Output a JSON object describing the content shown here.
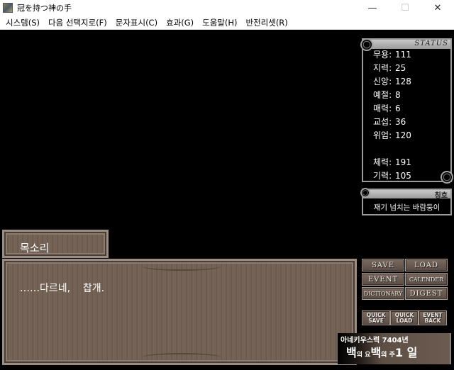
{
  "window": {
    "title": "冠を持つ神の手",
    "minimize": "—",
    "maximize": "☐",
    "close": "✕"
  },
  "menu": [
    {
      "label": "시스템(S)"
    },
    {
      "label": "다음 선택지로(F)"
    },
    {
      "label": "문자표시(C)"
    },
    {
      "label": "효과(G)"
    },
    {
      "label": "도움말(H)"
    },
    {
      "label": "반전리셋(R)"
    }
  ],
  "status": {
    "title": "STATUS",
    "stats": [
      {
        "label": "무용",
        "value": "111"
      },
      {
        "label": "지력",
        "value": "25"
      },
      {
        "label": "신앙",
        "value": "128"
      },
      {
        "label": "예절",
        "value": "8"
      },
      {
        "label": "매력",
        "value": "6"
      },
      {
        "label": "교섭",
        "value": "36"
      },
      {
        "label": "위엄",
        "value": "120"
      },
      {
        "label": "체력",
        "value": "191"
      },
      {
        "label": "기력",
        "value": "105"
      }
    ]
  },
  "honorific": {
    "header": "칭호",
    "value": "재기 넘치는 바람둥이"
  },
  "dialog": {
    "speaker": "목소리",
    "message": "……다르네,    찹개."
  },
  "buttons": {
    "save": "SAVE",
    "load": "LOAD",
    "event": "EVENT",
    "calender": "CALENDER",
    "dictionary": "DICTIONARY",
    "digest": "DIGEST",
    "quick_save": [
      "QUICK",
      "SAVE"
    ],
    "quick_load": [
      "QUICK",
      "LOAD"
    ],
    "event_back": [
      "EVENT",
      "BACK"
    ]
  },
  "date": {
    "era": "아네키우스력 7404년",
    "d1": "백",
    "d1s": "의 요",
    "d2": "백",
    "d2s": "의 주",
    "d3": "1 일"
  }
}
